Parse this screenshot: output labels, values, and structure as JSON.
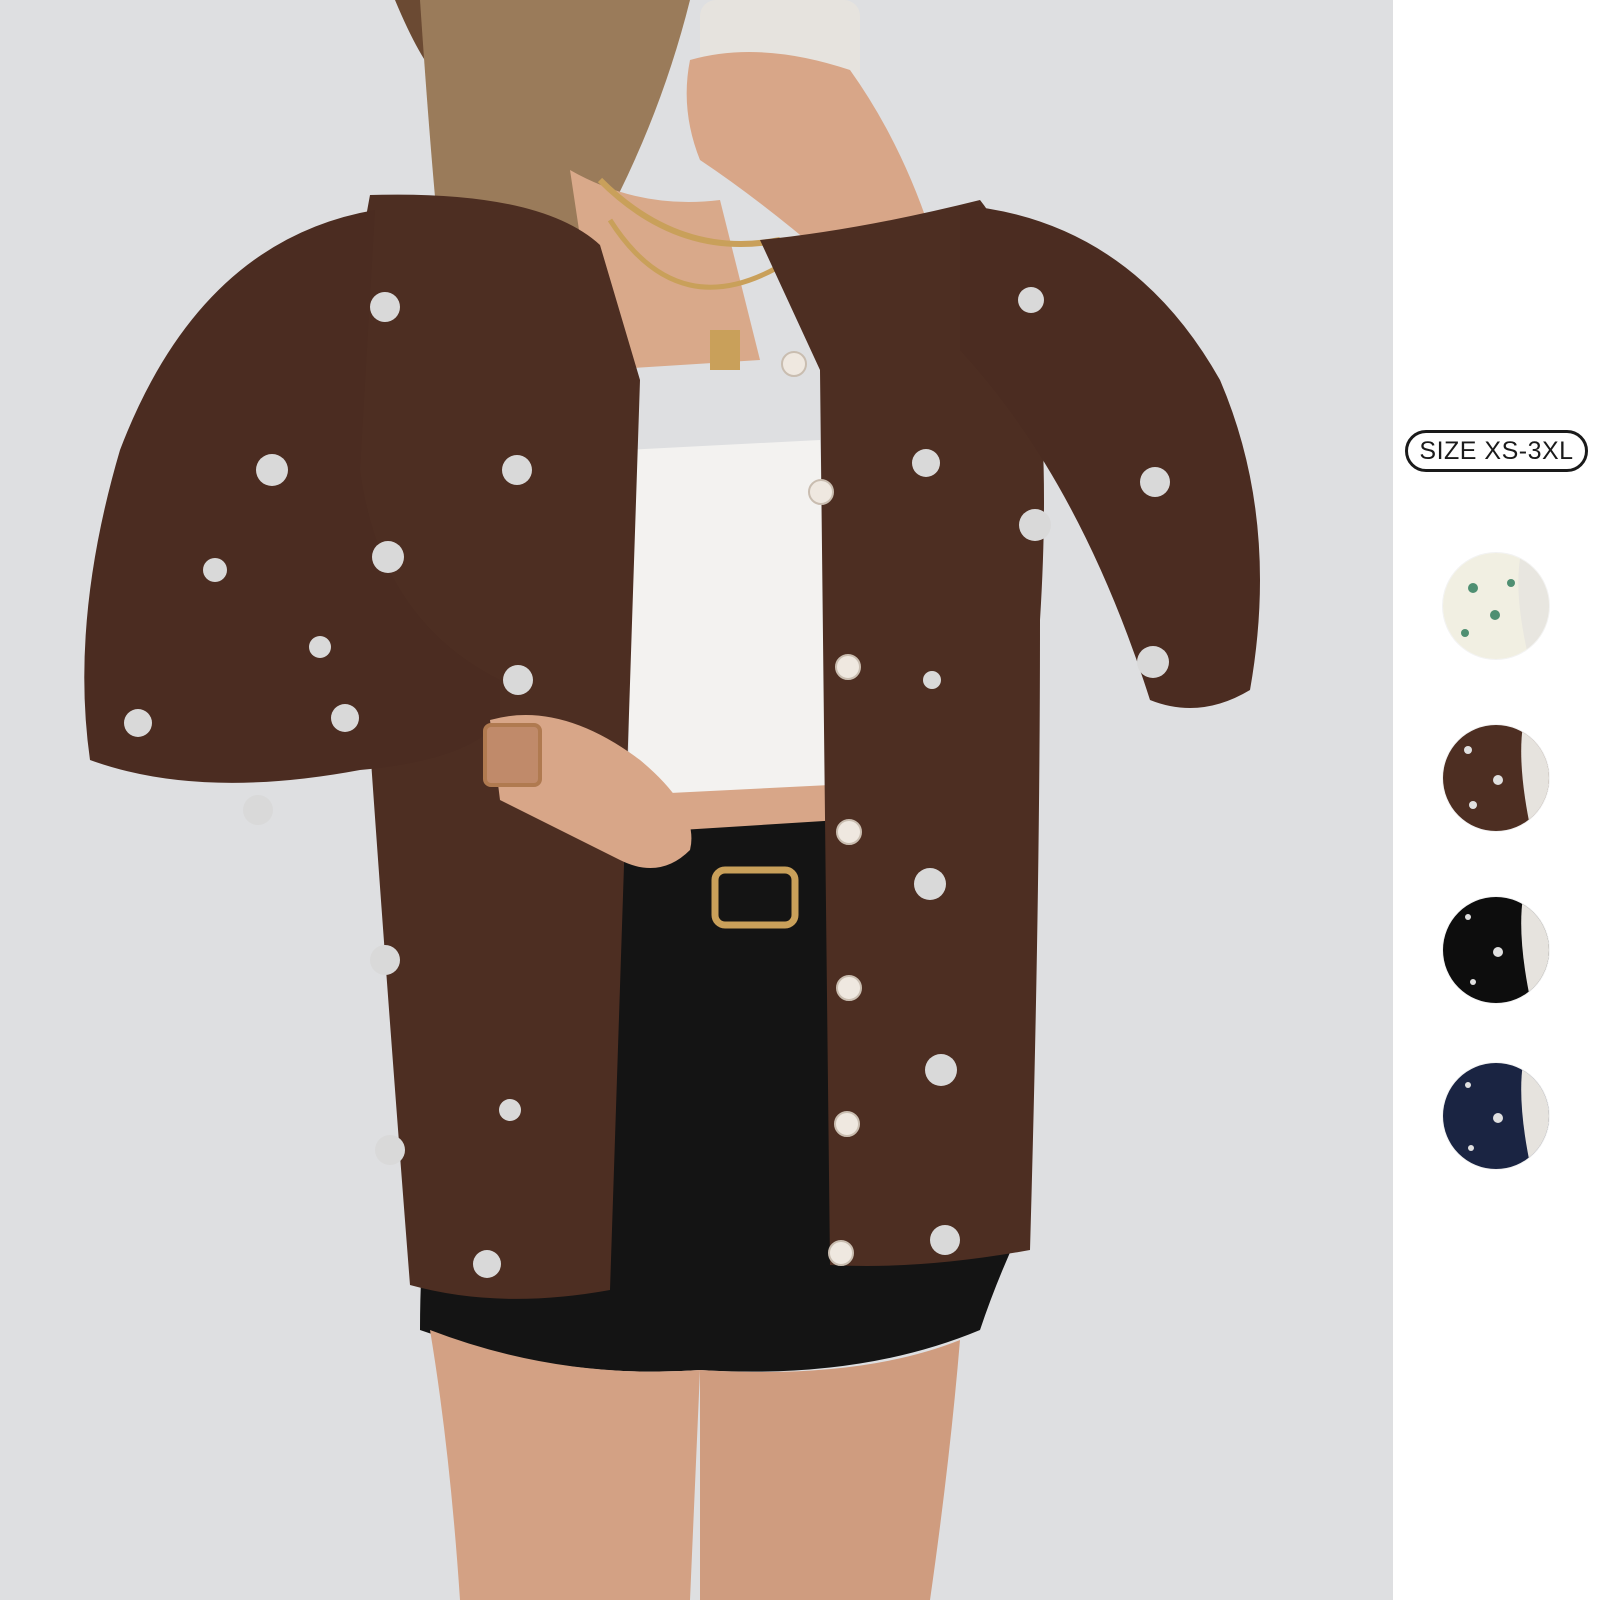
{
  "size_badge": {
    "label": "SIZE XS-3XL"
  },
  "main_photo": {
    "description_icon": "model-photo",
    "background_color": "#dedfe1",
    "cardigan_color": "#4d2e22",
    "dot_color": "#d9d9d9"
  },
  "color_swatches": [
    {
      "icon": "cream-cardigan-swatch",
      "color": "#f1efe2",
      "dot_color": "#4f8f72"
    },
    {
      "icon": "brown-cardigan-swatch",
      "color": "#4d2e22",
      "dot_color": "#e0e0e0"
    },
    {
      "icon": "black-cardigan-swatch",
      "color": "#0d0d0d",
      "dot_color": "#e0e0e0"
    },
    {
      "icon": "navy-cardigan-swatch",
      "color": "#1a2442",
      "dot_color": "#e0e0e0"
    }
  ]
}
